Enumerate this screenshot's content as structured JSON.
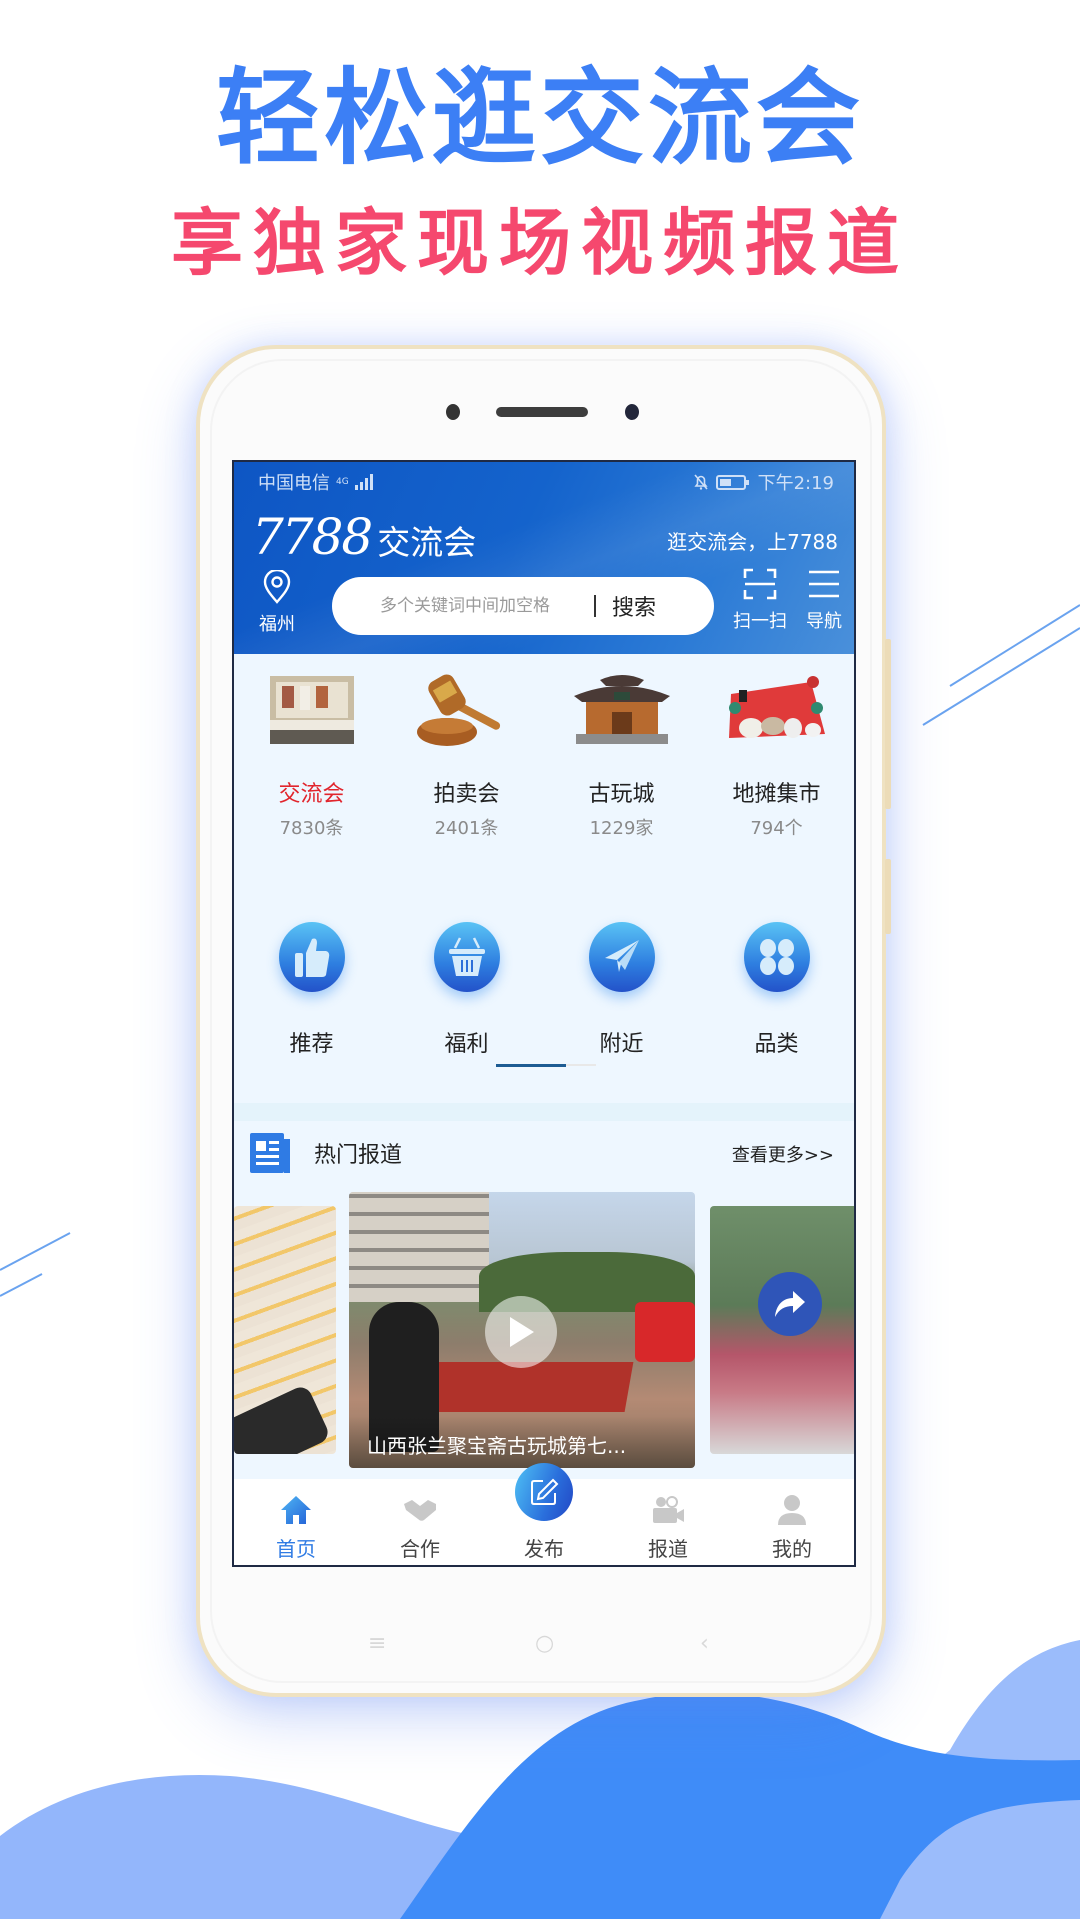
{
  "promo": {
    "headline": "轻松逛交流会",
    "subheadline": "享独家现场视频报道",
    "colors": {
      "headline": "#3c7ff5",
      "subheadline": "#f5486e",
      "wave_dark": "#3f8cf8",
      "wave_light": "#95b8fb"
    }
  },
  "status_bar": {
    "carrier": "中国电信",
    "network": "4G",
    "time": "下午2:19"
  },
  "header": {
    "logo_number": "7788",
    "logo_text": "交流会",
    "slogan": "逛交流会，上7788",
    "location": "福州",
    "search": {
      "placeholder": "多个关键词中间加空格",
      "value": "",
      "button": "搜索"
    },
    "scan_label": "扫一扫",
    "nav_label": "导航"
  },
  "categories": [
    {
      "name": "交流会",
      "count": "7830条",
      "active": true,
      "icon": "exhibition-icon"
    },
    {
      "name": "拍卖会",
      "count": "2401条",
      "active": false,
      "icon": "gavel-icon"
    },
    {
      "name": "古玩城",
      "count": "1229家",
      "active": false,
      "icon": "pavilion-icon"
    },
    {
      "name": "地摊集市",
      "count": "794个",
      "active": false,
      "icon": "market-stall-icon"
    }
  ],
  "quick_links": [
    {
      "name": "推荐",
      "icon": "thumbs-up-icon"
    },
    {
      "name": "福利",
      "icon": "basket-icon"
    },
    {
      "name": "附近",
      "icon": "paper-plane-icon"
    },
    {
      "name": "品类",
      "icon": "grid-icon"
    }
  ],
  "quick_links_pager": {
    "current_page": 1,
    "total_pages": 2
  },
  "hot_reports": {
    "title": "热门报道",
    "more": "查看更多>>",
    "videos": [
      {
        "caption": ""
      },
      {
        "caption": "山西张兰聚宝斋古玩城第七..."
      },
      {
        "caption": ""
      }
    ]
  },
  "tabbar": {
    "active_color": "#2f7be4",
    "items": [
      {
        "label": "首页",
        "icon": "home-icon",
        "active": true
      },
      {
        "label": "合作",
        "icon": "handshake-icon",
        "active": false
      },
      {
        "label": "发布",
        "icon": "edit-icon",
        "active": false
      },
      {
        "label": "报道",
        "icon": "video-camera-icon",
        "active": false
      },
      {
        "label": "我的",
        "icon": "user-icon",
        "active": false
      }
    ]
  }
}
